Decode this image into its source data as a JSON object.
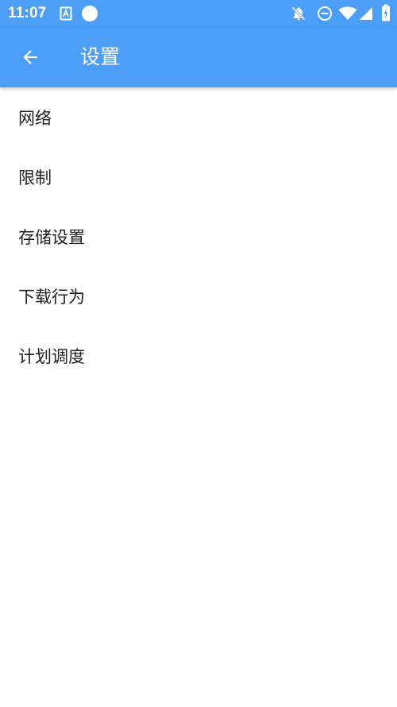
{
  "status_bar": {
    "time": "11:07",
    "icons": [
      "a-notification-icon",
      "circle-notification-icon",
      "notifications-off-icon",
      "do-not-disturb-icon",
      "wifi-icon",
      "cellular-signal-icon",
      "battery-charging-icon"
    ]
  },
  "app_bar": {
    "title": "设置",
    "back_icon": "arrow-back-icon",
    "color": "#4c9ef7"
  },
  "settings": {
    "items": [
      {
        "label": "网络"
      },
      {
        "label": "限制"
      },
      {
        "label": "存储设置"
      },
      {
        "label": "下载行为"
      },
      {
        "label": "计划调度"
      }
    ]
  }
}
